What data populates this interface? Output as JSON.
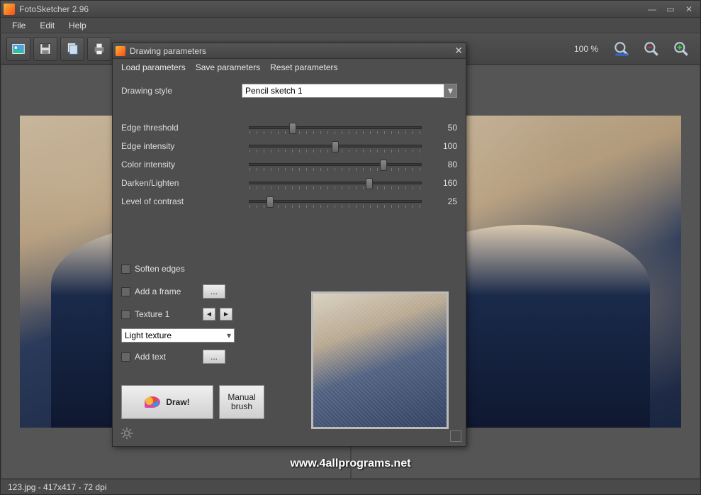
{
  "app": {
    "title": "FotoSketcher 2.96"
  },
  "menu": {
    "file": "File",
    "edit": "Edit",
    "help": "Help"
  },
  "toolbar": {
    "zoom_label": "100 %"
  },
  "dialog": {
    "title": "Drawing parameters",
    "menu": {
      "load": "Load parameters",
      "save": "Save parameters",
      "reset": "Reset parameters"
    },
    "style_label": "Drawing style",
    "style_value": "Pencil sketch 1",
    "sliders": [
      {
        "label": "Edge threshold",
        "value": 50,
        "pct": 25
      },
      {
        "label": "Edge intensity",
        "value": 100,
        "pct": 50
      },
      {
        "label": "Color intensity",
        "value": 80,
        "pct": 78
      },
      {
        "label": "Darken/Lighten",
        "value": 160,
        "pct": 70
      },
      {
        "label": "Level of contrast",
        "value": 25,
        "pct": 12
      }
    ],
    "soften": "Soften edges",
    "frame": "Add a frame",
    "frame_btn": "...",
    "texture_label": "Texture 1",
    "texture_value": "Light texture",
    "addtext": "Add text",
    "addtext_btn": "...",
    "draw": "Draw!",
    "manual": "Manual brush"
  },
  "watermark": "www.4allprograms.net",
  "status": "123.jpg - 417x417 - 72 dpi"
}
